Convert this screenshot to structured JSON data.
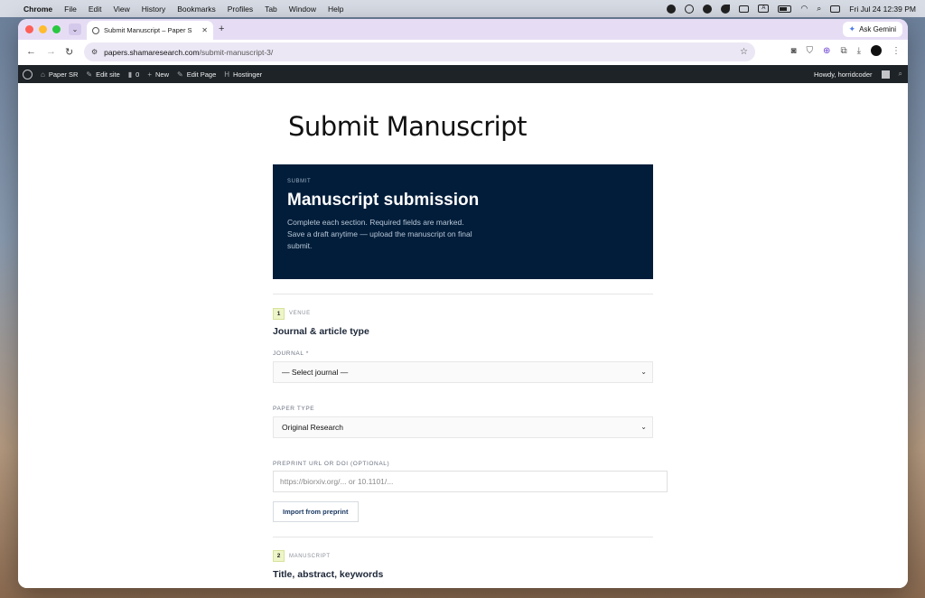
{
  "menubar": {
    "app": "Chrome",
    "menus": [
      "File",
      "Edit",
      "View",
      "History",
      "Bookmarks",
      "Profiles",
      "Tab",
      "Window",
      "Help"
    ],
    "clock": "Fri Jul 24  12:39 PM"
  },
  "browser": {
    "tab_title": "Submit Manuscript – Paper S",
    "url_host": "papers.shamaresearch.com",
    "url_path": "/submit-manuscript-3/",
    "gemini_label": "Ask Gemini"
  },
  "wpbar": {
    "site": "Paper SR",
    "edit_site": "Edit site",
    "comments": "0",
    "new": "New",
    "edit_page": "Edit Page",
    "hostinger": "Hostinger",
    "howdy": "Howdy, horridcoder"
  },
  "page": {
    "title": "Submit Manuscript",
    "hero": {
      "eyebrow": "SUBMIT",
      "heading": "Manuscript submission",
      "body": "Complete each section. Required fields are marked. Save a draft anytime — upload the manuscript on final submit."
    },
    "section1": {
      "number": "1",
      "label": "VENUE",
      "heading": "Journal & article type",
      "journal_label": "JOURNAL *",
      "journal_value": "— Select journal —",
      "paper_type_label": "PAPER TYPE",
      "paper_type_value": "Original Research",
      "preprint_label": "PREPRINT URL OR DOI (OPTIONAL)",
      "preprint_placeholder": "https://biorxiv.org/... or 10.1101/...",
      "import_button": "Import from preprint"
    },
    "section2": {
      "number": "2",
      "label": "MANUSCRIPT",
      "heading": "Title, abstract, keywords"
    }
  }
}
